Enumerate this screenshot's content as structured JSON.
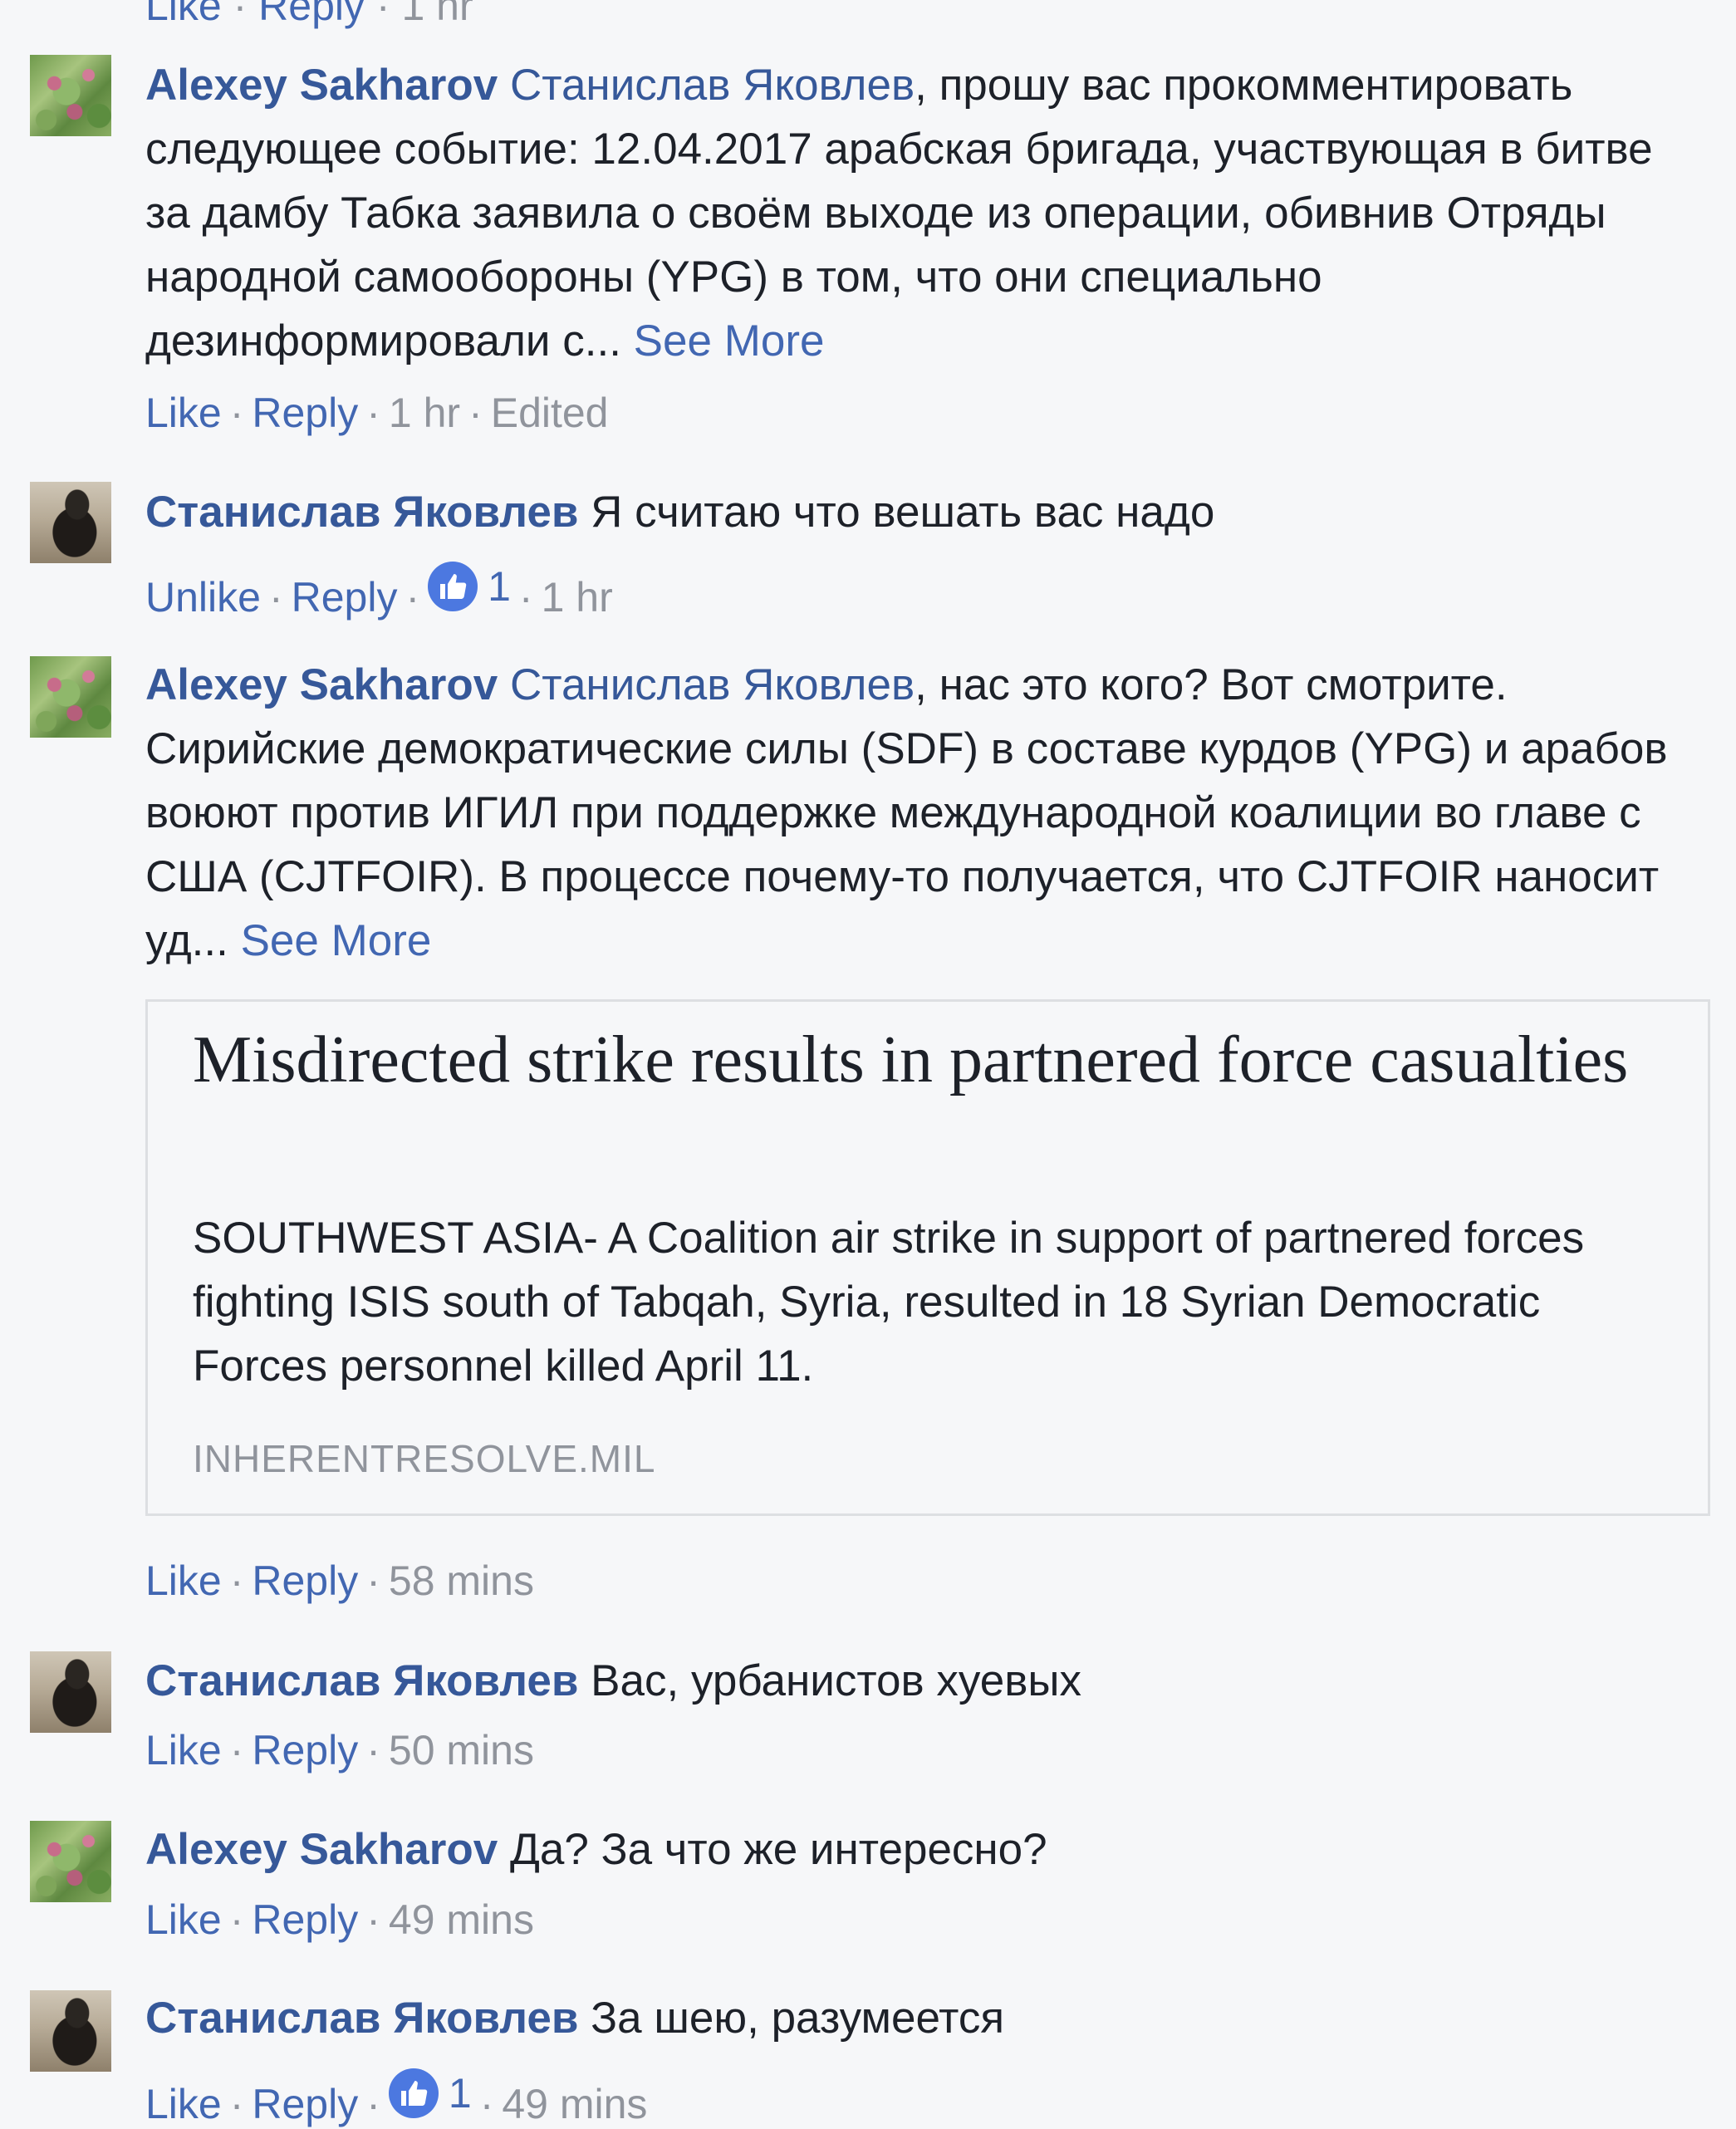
{
  "top_cut": {
    "like": "Like",
    "reply": "Reply",
    "time": "1 hr"
  },
  "comments": [
    {
      "author": "Alexey Sakharov",
      "mention": "Станислав Яковлев",
      "text": ", прошу вас прокомментировать следующее событие: 12.04.2017 арабская бригада, участвующая в битве за дамбу Табка заявила о своём выходе из операции, обивнив Отряды народной самообороны (YPG) в том, что они специально дезинформировали с...",
      "see_more": "See More",
      "like": "Like",
      "reply": "Reply",
      "time": "1 hr",
      "edited": "Edited"
    },
    {
      "author": "Станислав Яковлев",
      "text": "Я считаю что вешать вас надо",
      "like": "Unlike",
      "reply": "Reply",
      "likes_count": "1",
      "time": "1 hr"
    },
    {
      "author": "Alexey Sakharov",
      "mention": "Станислав Яковлев",
      "text": ", нас это кого? Вот смотрите. Сирийские демократические силы (SDF) в составе курдов (YPG) и арабов воюют против ИГИЛ при поддержке международной коалиции во главе с США (CJTFOIR). В процессе почему-то получается, что CJTFOIR наносит уд...",
      "see_more": "See More",
      "link_card": {
        "title": "Misdirected strike results in partnered force casualties",
        "description": "SOUTHWEST ASIA- A Coalition air strike in support of partnered forces fighting ISIS south of Tabqah, Syria, resulted in 18 Syrian Democratic Forces personnel killed April 11.",
        "domain": "INHERENTRESOLVE.MIL"
      },
      "like": "Like",
      "reply": "Reply",
      "time": "58 mins"
    },
    {
      "author": "Станислав Яковлев",
      "text": "Вас, урбанистов хуевых",
      "like": "Like",
      "reply": "Reply",
      "time": "50 mins"
    },
    {
      "author": "Alexey Sakharov",
      "text": "Да? За что же интересно?",
      "like": "Like",
      "reply": "Reply",
      "time": "49 mins"
    },
    {
      "author": "Станислав Яковлев",
      "text": "За шею, разумеется",
      "like": "Like",
      "reply": "Reply",
      "likes_count": "1",
      "time": "49 mins"
    }
  ],
  "colors": {
    "background": "#f6f7f9",
    "author": "#365899",
    "link": "#4267b2",
    "meta": "#90949c",
    "text": "#1d2129",
    "like_badge": "#4c78e0"
  }
}
